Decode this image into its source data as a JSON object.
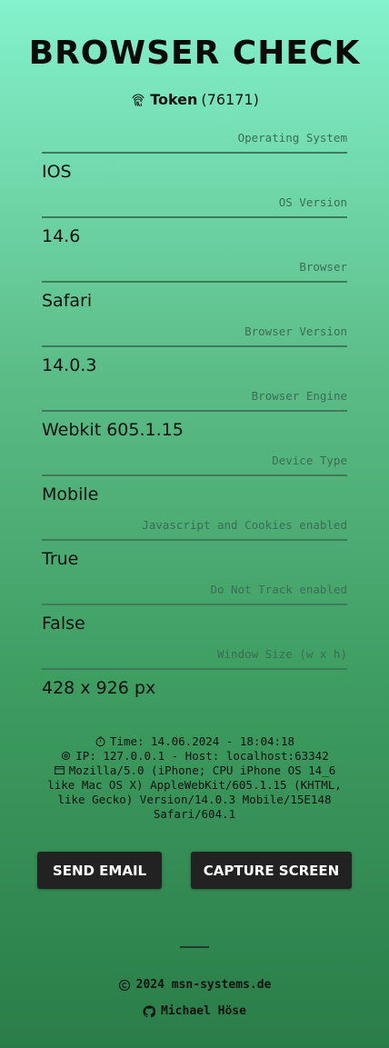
{
  "header": {
    "title": "BROWSER CHECK",
    "token_label": "Token",
    "token_value": "(76171)"
  },
  "fields": [
    {
      "label": "Operating System",
      "value": "IOS"
    },
    {
      "label": "OS Version",
      "value": "14.6"
    },
    {
      "label": "Browser",
      "value": "Safari"
    },
    {
      "label": "Browser Version",
      "value": "14.0.3"
    },
    {
      "label": "Browser Engine",
      "value": "Webkit 605.1.15"
    },
    {
      "label": "Device Type",
      "value": "Mobile"
    },
    {
      "label": "Javascript and Cookies enabled",
      "value": "True"
    },
    {
      "label": "Do Not Track enabled",
      "value": "False"
    },
    {
      "label": "Window Size (w x h)",
      "value": "428 x 926 px"
    }
  ],
  "info": {
    "time": "Time: 14.06.2024 - 18:04:18",
    "ip": "IP: 127.0.0.1 - Host: localhost:63342",
    "user_agent": "Mozilla/5.0 (iPhone; CPU iPhone OS 14_6 like Mac OS X) AppleWebKit/605.1.15 (KHTML, like Gecko) Version/14.0.3 Mobile/15E148 Safari/604.1"
  },
  "buttons": {
    "send_email": "SEND EMAIL",
    "capture_screen": "CAPTURE SCREEN"
  },
  "footer": {
    "copyright": "2024 msn-systems.de",
    "author": "Michael Höse"
  },
  "icons": [
    "fingerprint-icon",
    "timer-icon",
    "location-icon",
    "window-icon",
    "copyright-icon",
    "github-icon"
  ]
}
